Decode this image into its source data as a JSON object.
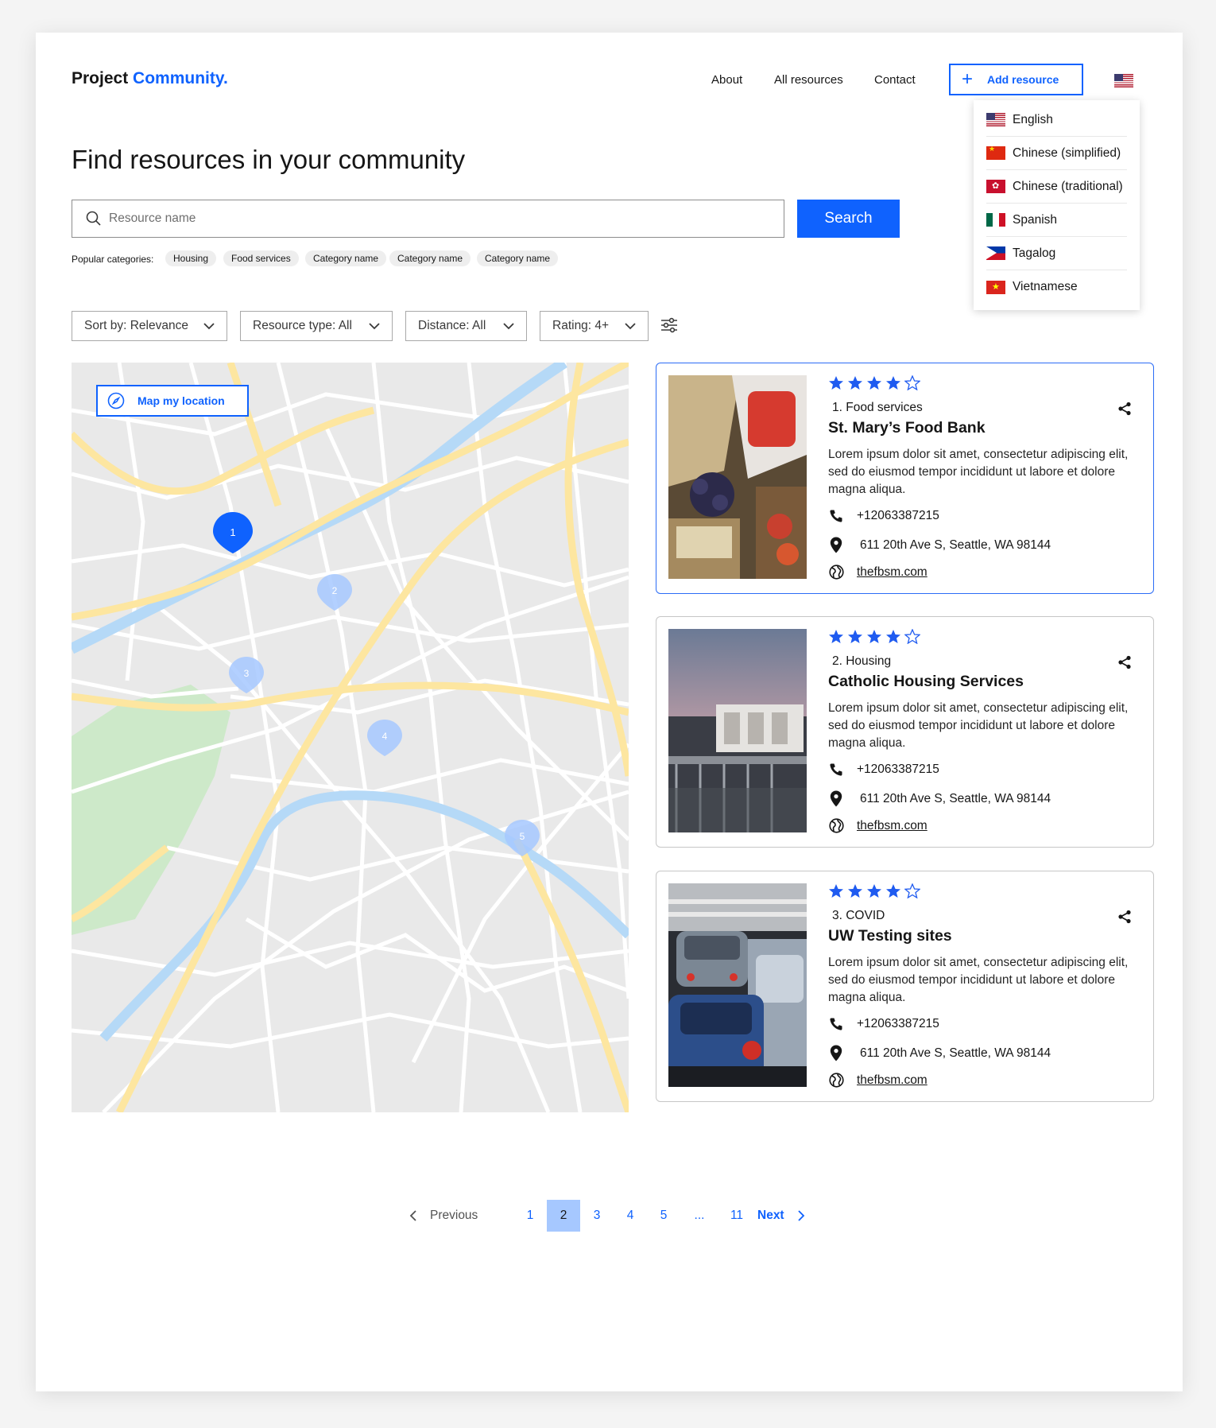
{
  "header": {
    "logo_main": "Project",
    "logo_accent": "Community.",
    "nav": [
      "About",
      "All resources",
      "Contact"
    ],
    "add_resource": "Add resource"
  },
  "languages": [
    {
      "label": "English",
      "flag": "us"
    },
    {
      "label": "Chinese (simplified)",
      "flag": "cn"
    },
    {
      "label": "Chinese (traditional)",
      "flag": "hk"
    },
    {
      "label": "Spanish",
      "flag": "mx"
    },
    {
      "label": "Tagalog",
      "flag": "ph"
    },
    {
      "label": "Vietnamese",
      "flag": "vn"
    }
  ],
  "main": {
    "title": "Find resources in your community",
    "search_placeholder": "Resource name",
    "search_button": "Search",
    "popular_label": "Popular categories:",
    "categories": [
      "Housing",
      "Food services",
      "Category name",
      "Category name",
      "Category name"
    ]
  },
  "filters": [
    "Sort by: Relevance",
    "Resource type: All",
    "Distance: All",
    "Rating: 4+"
  ],
  "map": {
    "location_button": "Map my location",
    "pins": [
      "1",
      "2",
      "3",
      "4",
      "5"
    ]
  },
  "colors": {
    "accent": "#0f62fe",
    "star": "#1f5bf0",
    "road_major": "#fde6a0",
    "water": "#b5d9f7",
    "park": "#cde9c9"
  },
  "results": [
    {
      "rating": 4,
      "category": "1. Food services",
      "name": "St. Mary’s Food Bank",
      "description": "Lorem ipsum dolor sit amet, consectetur adipiscing elit, sed do eiusmod tempor incididunt ut labore et dolore magna aliqua.",
      "phone": "+12063387215",
      "address": "611 20th Ave S, Seattle, WA 98144",
      "website": "thefbsm.com"
    },
    {
      "rating": 4,
      "category": "2. Housing",
      "name": "Catholic Housing Services",
      "description": "Lorem ipsum dolor sit amet, consectetur adipiscing elit, sed do eiusmod tempor incididunt ut labore et dolore magna aliqua.",
      "phone": "+12063387215",
      "address": "611 20th Ave S, Seattle, WA 98144",
      "website": "thefbsm.com"
    },
    {
      "rating": 4,
      "category": "3. COVID",
      "name": "UW Testing sites",
      "description": "Lorem ipsum dolor sit amet, consectetur adipiscing elit, sed do eiusmod tempor incididunt ut labore et dolore magna aliqua.",
      "phone": "+12063387215",
      "address": "611 20th Ave S, Seattle, WA 98144",
      "website": "thefbsm.com"
    }
  ],
  "pagination": {
    "previous": "Previous",
    "pages": [
      "1",
      "2",
      "3",
      "4",
      "5",
      "...",
      "11"
    ],
    "current": "2",
    "next": "Next"
  }
}
